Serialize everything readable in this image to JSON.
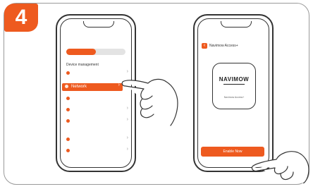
{
  "step": {
    "number": "4"
  },
  "phone1": {
    "progress_fraction": 0.5,
    "section_title": "Device management",
    "network_label": "Network",
    "menu_icon": "chevron-right-icon"
  },
  "phone2": {
    "back_icon": "chevron-left-icon",
    "title": "Navimow Access+",
    "brand": "NAVIMOW",
    "device_label": "Navimow Access+",
    "button_label": "Enable Now"
  },
  "colors": {
    "accent": "#ee5a1f",
    "outline": "#333333",
    "card_border": "#9a9a9a"
  }
}
